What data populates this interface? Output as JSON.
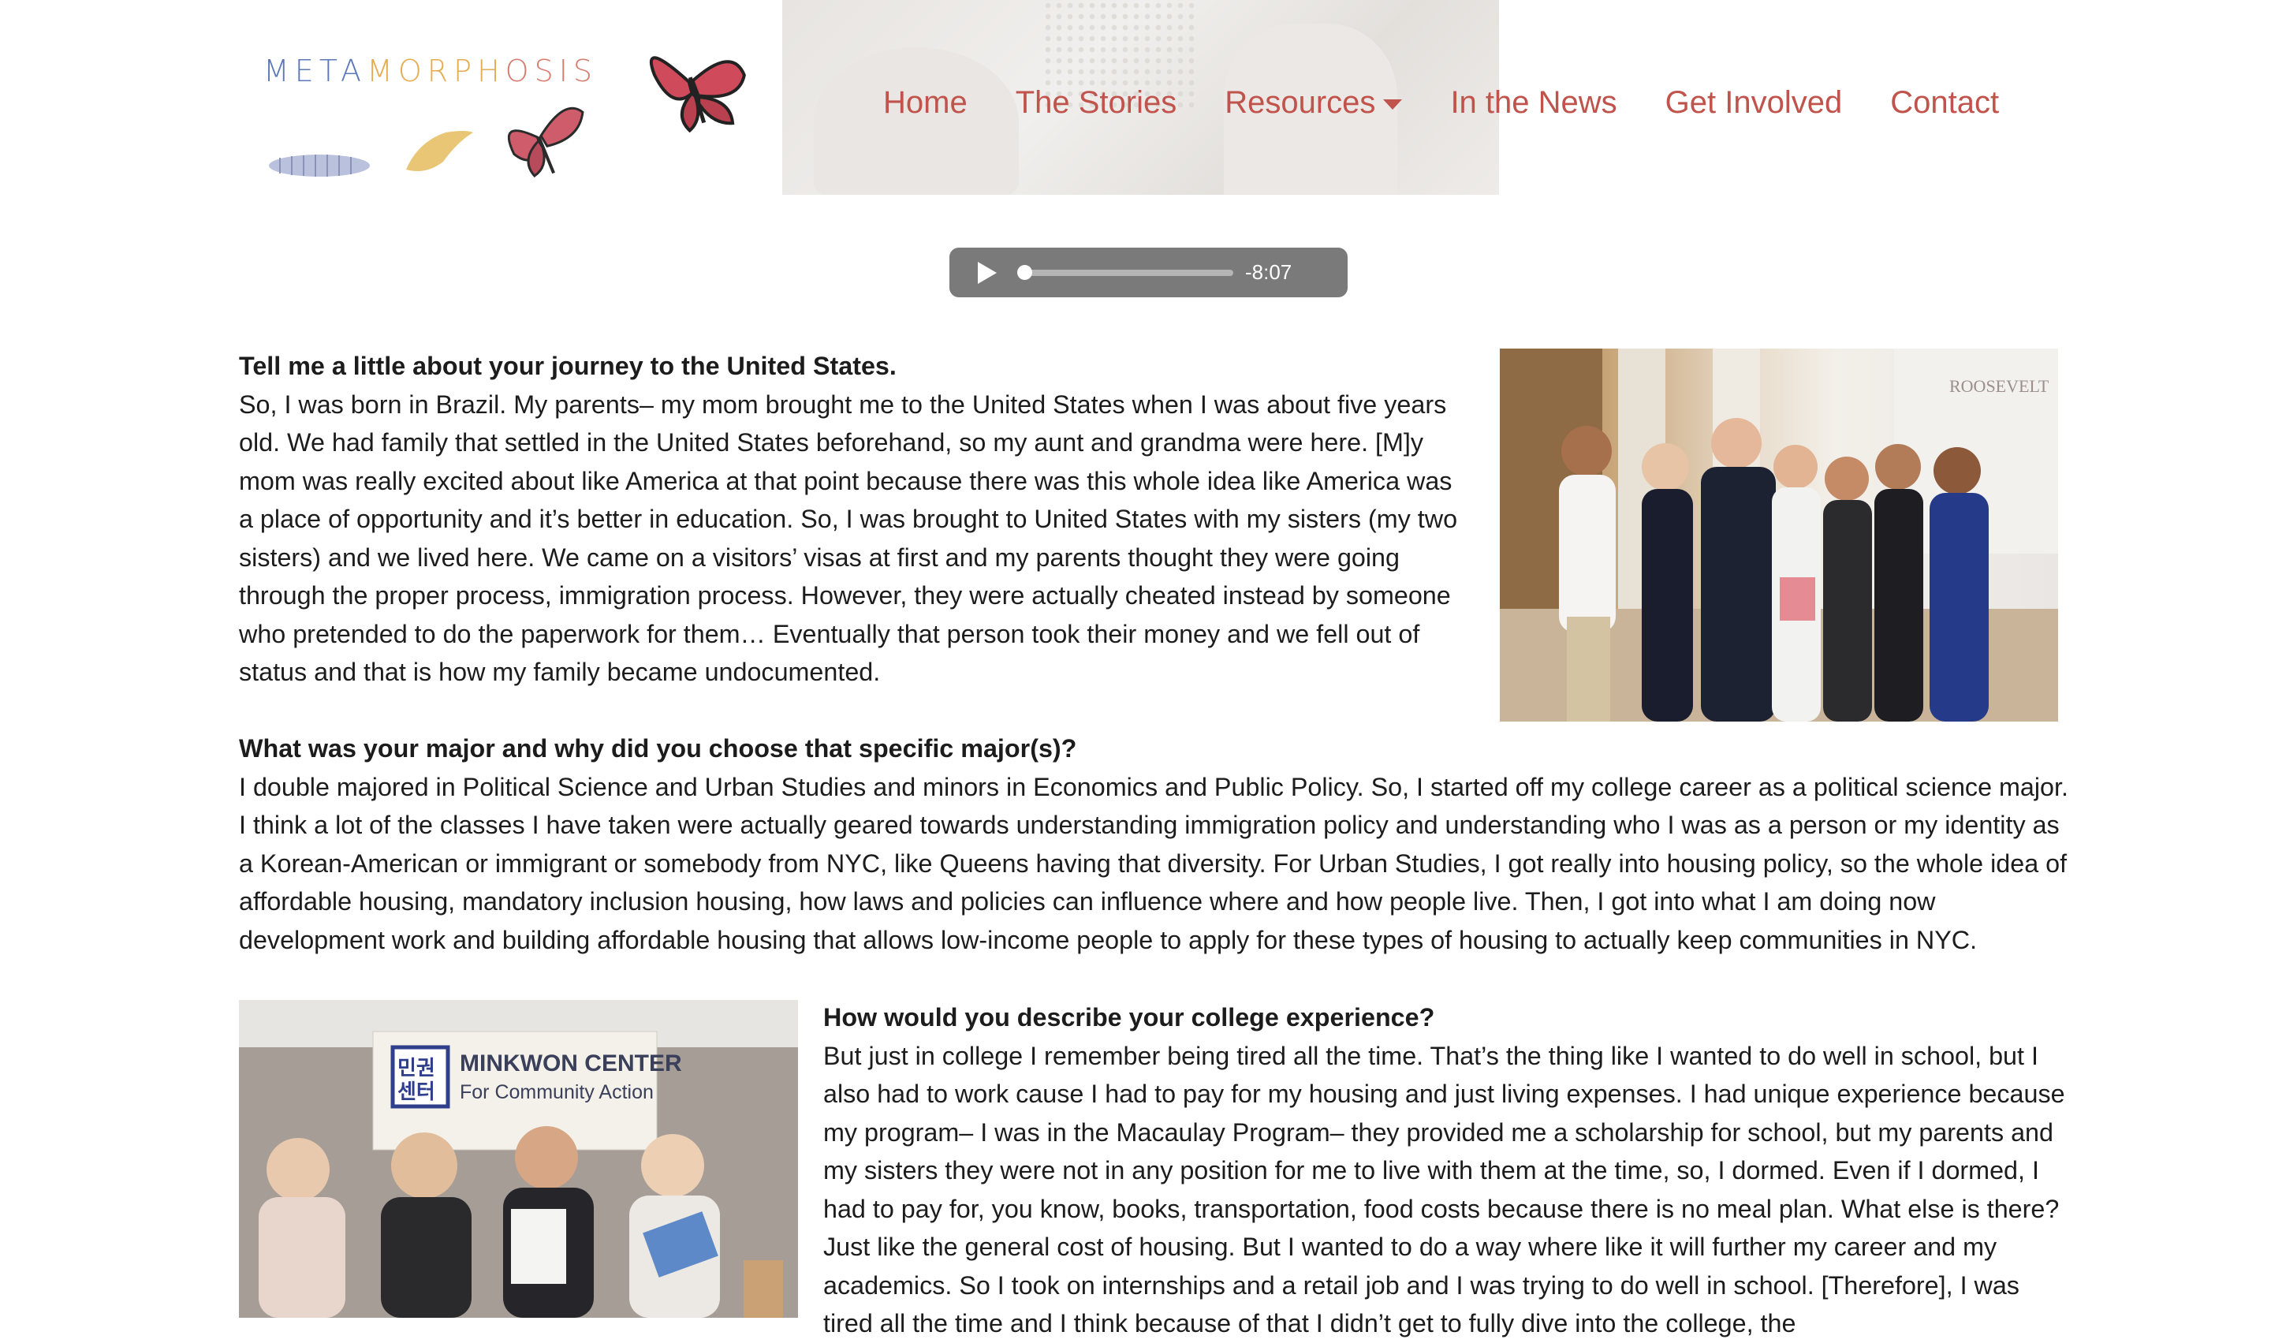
{
  "brand": {
    "logo_part1": "META",
    "logo_part2": "MORPH",
    "logo_part3": "OSIS",
    "colors": {
      "blue": "#5b78b8",
      "gold": "#e4ac4f",
      "coral": "#d77b6e",
      "nav": "#c0534b"
    }
  },
  "nav": {
    "items": [
      "Home",
      "The Stories",
      "Resources",
      "In the News",
      "Get Involved",
      "Contact"
    ]
  },
  "audio": {
    "remaining": "-8:07",
    "progress": 0.0
  },
  "content": {
    "q1": "Tell me a little about your journey to the United States.",
    "a1": "So, I was born in Brazil. My parents– my mom brought me to the United States when I was about five years old. We had family that settled in the United States beforehand, so my aunt and grandma were here. [M]y mom was really excited about like America at that point because there was this whole idea like America was a place of opportunity and it’s better in education. So, I was brought to United States with my sisters (my two sisters) and we lived here. We came on a visitors’ visas at first and my parents thought they were going through the proper process, immigration process. However, they were actually cheated instead by someone who pretended to do the paperwork for them… Eventually that person took their money and we fell out of status and that is how my family became undocumented.",
    "q2": "What was your major and why did you choose that specific major(s)?",
    "a2": "I double majored in Political Science and Urban Studies and minors in Economics and Public Policy. So, I started off my college career as a political science major. I think a lot of the classes I have taken were actually geared towards understanding immigration policy and understanding who I was as a person or my identity as a Korean-American or immigrant or somebody from NYC, like Queens having that diversity. For Urban Studies, I got really into housing policy, so the whole idea of affordable housing, mandatory inclusion housing, how laws and policies can influence where and how people live. Then, I got into what I am doing now development work and building affordable housing that allows low-income people to apply for these types of housing to actually keep communities in NYC.",
    "q3": "How would you describe your college experience?",
    "a3": "But just in college I remember being tired all the time. That’s the thing like I wanted to do well in school, but I also had to work cause I had to pay for my housing and just living expenses. I had unique experience because my program– I was in the Macaulay Program– they provided me a scholarship for school, but my parents and my sisters they were not in any position for me to live with them at the time, so, I dormed. Even if I dormed, I had to pay for, you know, books, transportation, food costs because there is no meal plan. What else is there? Just like the general cost of housing. But I wanted to do a way where like it will further my career and my academics. So I took on internships and a retail job and I was trying to do well in school. [Therefore], I was tired all the time and I think because of that I didn’t get to fully dive into the college, the"
  },
  "photos": {
    "photo1_sign": "ROOSEVELT",
    "photo2_banner_title": "MINKWON CENTER",
    "photo2_banner_sub": "For Community Action",
    "photo2_logo": "민권\n센터"
  }
}
